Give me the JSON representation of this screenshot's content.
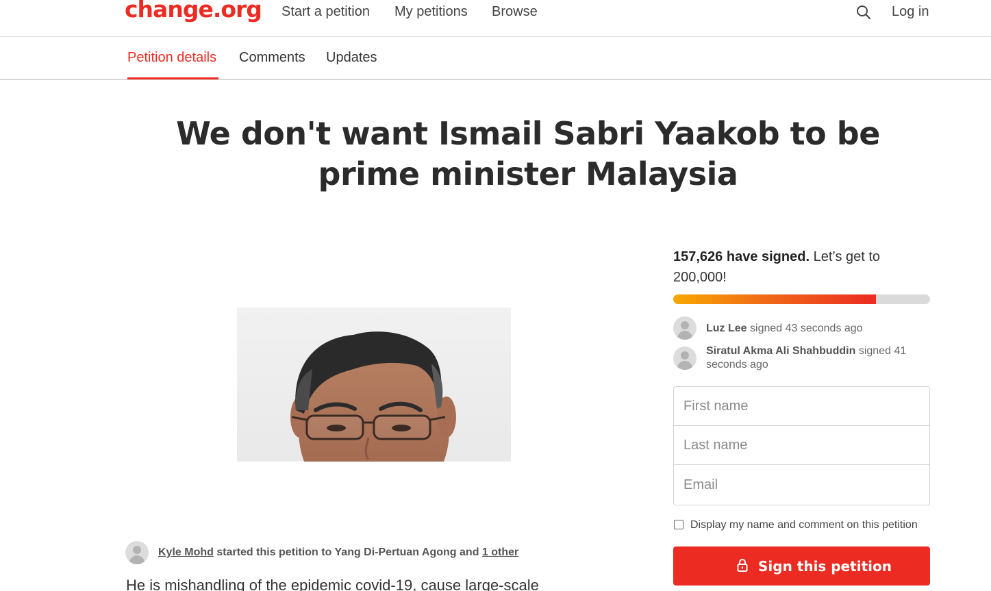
{
  "header": {
    "logo": "change.org",
    "nav": [
      "Start a petition",
      "My petitions",
      "Browse"
    ],
    "search_icon": "search-icon",
    "login": "Log in"
  },
  "tabs": [
    {
      "label": "Petition details",
      "active": true
    },
    {
      "label": "Comments",
      "active": false
    },
    {
      "label": "Updates",
      "active": false
    }
  ],
  "petition": {
    "title": "We don't want Ismail Sabri Yaakob to be prime minister Malaysia",
    "starter_name": "Kyle Mohd",
    "starter_text": "started this petition to Yang Di-Pertuan Agong and",
    "starter_other": "1 other",
    "body_excerpt": "He is mishandling of the epidemic covid-19, cause large-scale"
  },
  "signatures": {
    "count_bold": "157,626 have signed.",
    "count_rest": "Let’s get to 200,000!",
    "signed": 157626,
    "goal": 200000,
    "progress_fraction": 0.788,
    "recent": [
      {
        "name": "Luz Lee",
        "action": "signed 43 seconds ago"
      },
      {
        "name": "Siratul Akma Ali Shahbuddin",
        "action": "signed 41 seconds ago"
      }
    ]
  },
  "form": {
    "first_name_placeholder": "First name",
    "last_name_placeholder": "Last name",
    "email_placeholder": "Email",
    "display_checkbox_label": "Display my name and comment on this petition",
    "sign_button": "Sign this petition",
    "lock_icon": "lock-icon"
  },
  "colors": {
    "brand_red": "#ec2c22",
    "progress_start": "#f8a800",
    "progress_end": "#ec2c22"
  }
}
